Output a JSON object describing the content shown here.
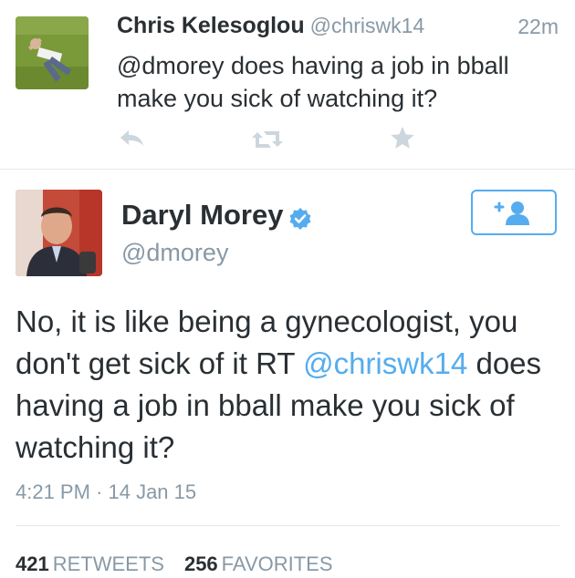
{
  "reply_tweet": {
    "name": "Chris Kelesoglou",
    "handle": "@chriswk14",
    "time": "22m",
    "text": "@dmorey does having a job in bball make you sick of watching it?",
    "actions": [
      {
        "icon": "reply-icon"
      },
      {
        "icon": "retweet-icon"
      },
      {
        "icon": "favorite-star-icon"
      }
    ]
  },
  "main_tweet": {
    "name": "Daryl Morey",
    "verified": true,
    "handle": "@dmorey",
    "follow_icon": "add-user-icon",
    "text_before_mention": "No, it is like being a gynecologist, you don't get sick of it RT ",
    "mention": "@chriswk14",
    "text_after_mention": " does having a job in bball make you sick of watching it?",
    "timestamp": "4:21 PM · 14 Jan 15",
    "retweets_count": "421",
    "retweets_label": "RETWEETS",
    "favorites_count": "256",
    "favorites_label": "FAVORITES"
  },
  "colors": {
    "accent": "#55acee",
    "text": "#292f33",
    "secondary_text": "#8899a6",
    "icon_gray": "#ccd6dd",
    "divider": "#e1e8ed"
  }
}
